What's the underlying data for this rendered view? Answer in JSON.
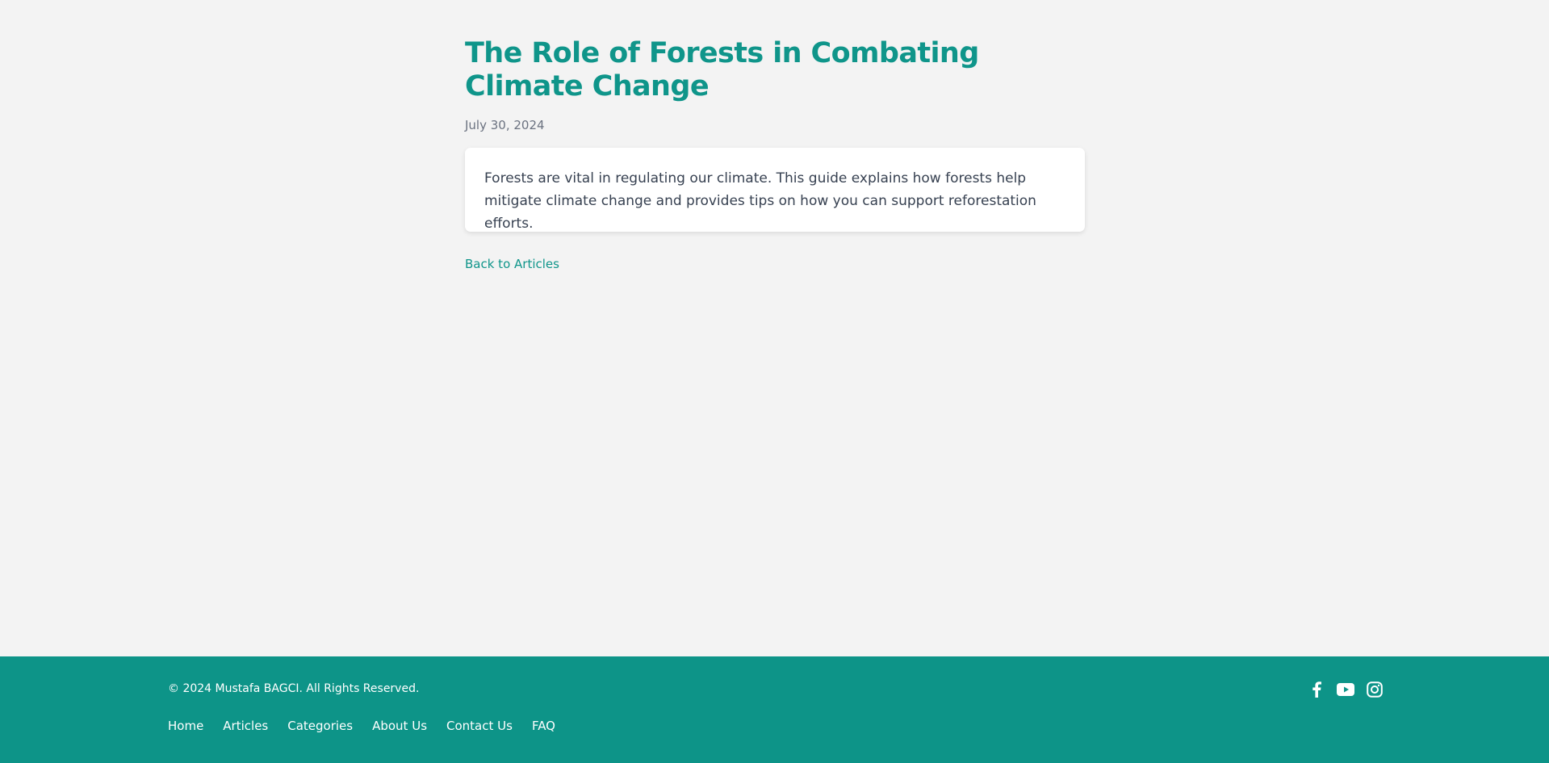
{
  "article": {
    "title": "The Role of Forests in Combating Climate Change",
    "date": "July 30, 2024",
    "body": "Forests are vital in regulating our climate. This guide explains how forests help mitigate climate change and provides tips on how you can support reforestation efforts.",
    "back_link": "Back to Articles"
  },
  "footer": {
    "copyright": "© 2024 Mustafa BAGCI. All Rights Reserved.",
    "nav": [
      {
        "label": "Home"
      },
      {
        "label": "Articles"
      },
      {
        "label": "Categories"
      },
      {
        "label": "About Us"
      },
      {
        "label": "Contact Us"
      },
      {
        "label": "FAQ"
      }
    ],
    "social": [
      {
        "icon": "facebook-icon"
      },
      {
        "icon": "youtube-icon"
      },
      {
        "icon": "instagram-icon"
      }
    ]
  },
  "colors": {
    "accent": "#0f958a",
    "footer_bg": "#0d9488",
    "page_bg": "#f3f3f3"
  }
}
